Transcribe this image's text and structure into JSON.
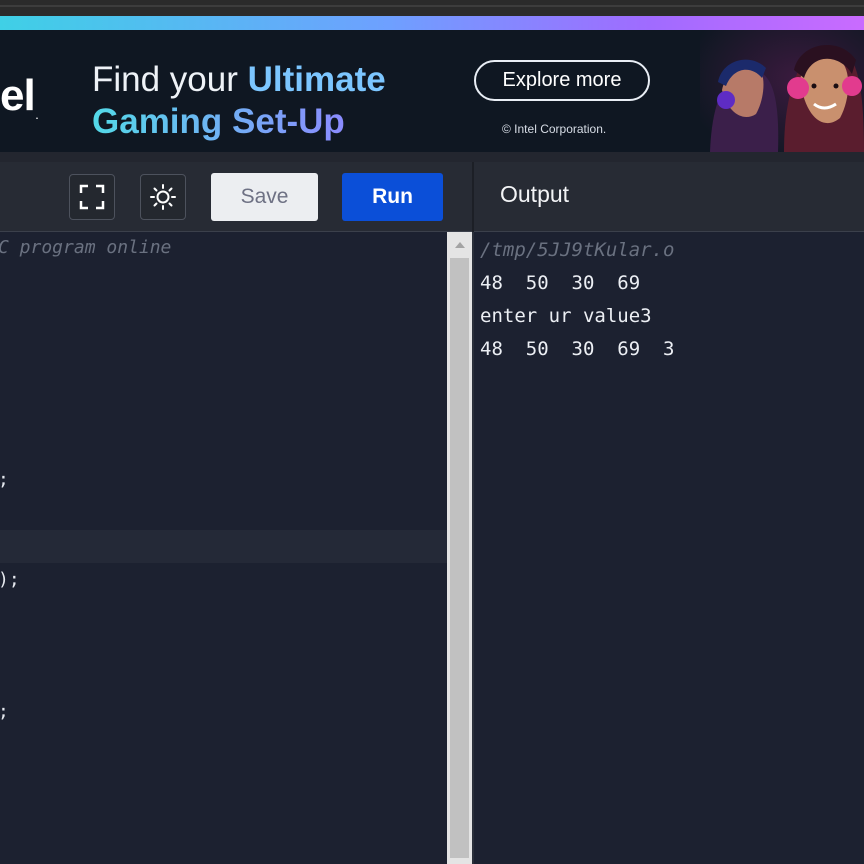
{
  "ad": {
    "logo_text": "el",
    "logo_mark": ".",
    "headline_plain": "Find your ",
    "headline_accent": "Ultimate",
    "headline_line2": "Gaming Set-Up",
    "cta_label": "Explore more",
    "copyright": "© Intel Corporation.",
    "colors": {
      "gradient_start": "#3fd0e6",
      "gradient_end": "#c96bff",
      "background": "#0f1722"
    }
  },
  "toolbar": {
    "fullscreen_icon": "fullscreen-icon",
    "theme_icon": "sun-icon",
    "save_label": "Save",
    "run_label": "Run",
    "output_title": "Output",
    "colors": {
      "run": "#0b4fd8",
      "save": "#eceef1"
    }
  },
  "editor": {
    "lines": [
      {
        "text": "C program online",
        "style": "comment"
      },
      {
        "text": ";",
        "style": "code"
      },
      {
        "text": ");",
        "style": "code"
      },
      {
        "text": ";",
        "style": "code"
      }
    ]
  },
  "output": {
    "path": "/tmp/5JJ9tKular.o",
    "lines": [
      "48  50  30  69",
      "enter ur value3",
      "48  50  30  69  3"
    ]
  }
}
